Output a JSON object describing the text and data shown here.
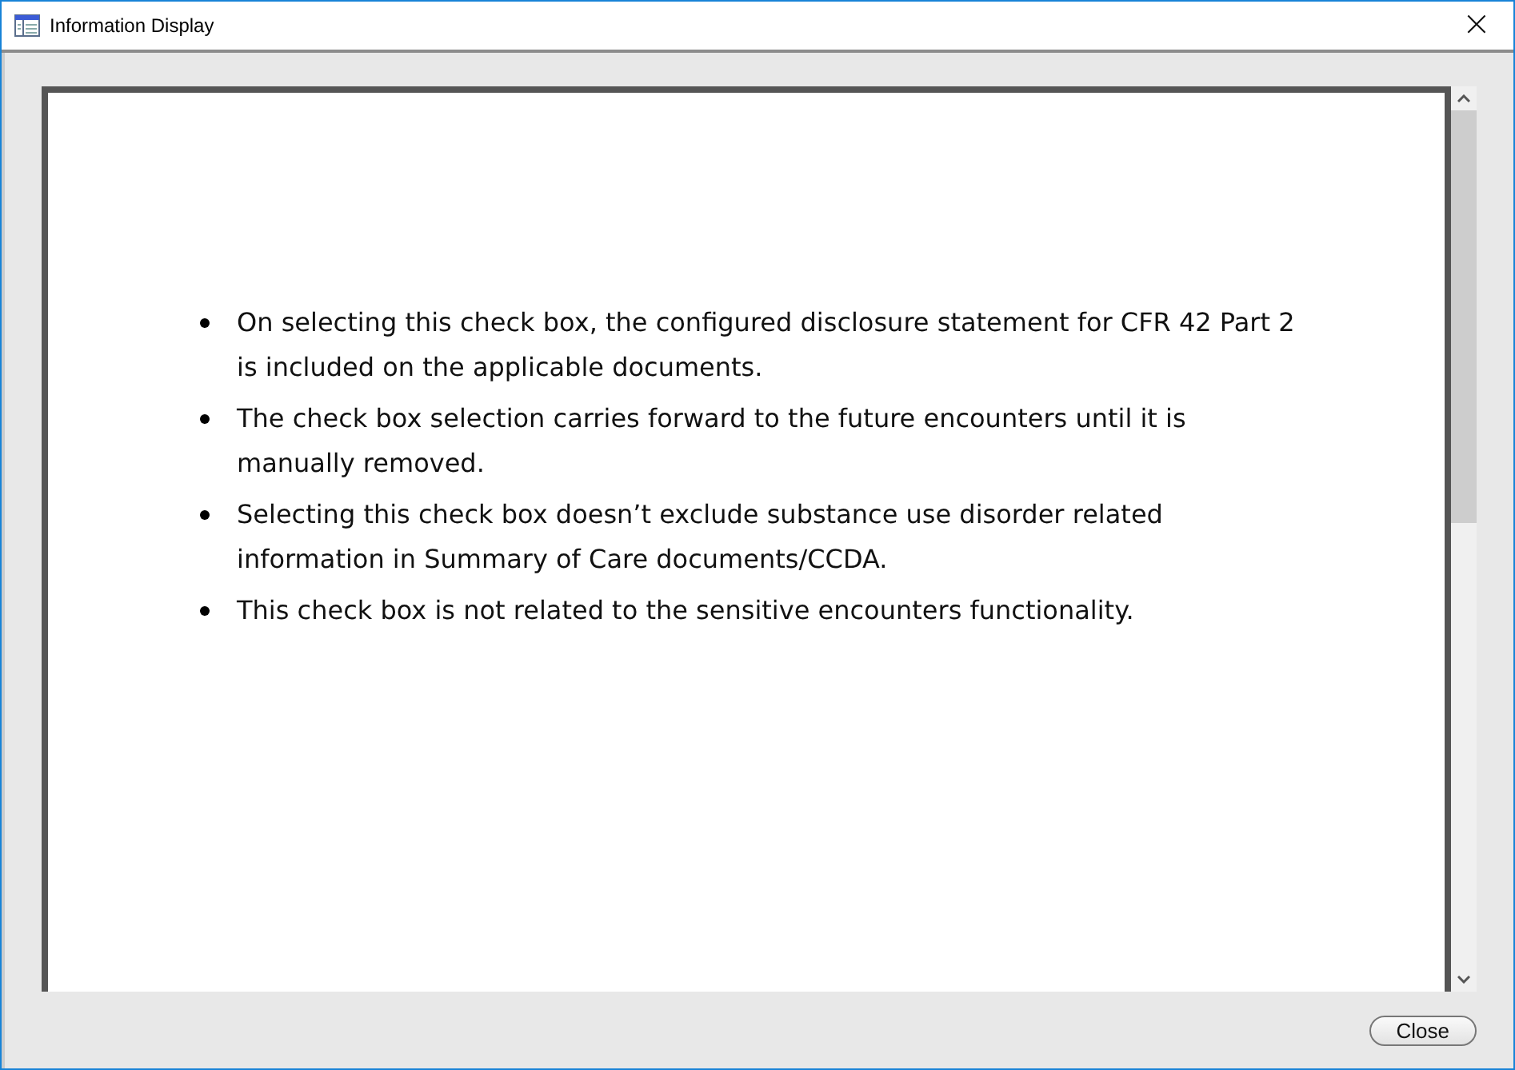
{
  "window": {
    "title": "Information Display",
    "close_glyph": "×"
  },
  "document": {
    "bullets": [
      "On selecting this check box, the configured disclosure statement for CFR 42 Part 2 is included on the applicable documents.",
      "The check box selection carries forward to the future encounters until it is manually removed.",
      "Selecting this check box doesn’t exclude substance use disorder related information in Summary of Care documents/CCDA.",
      "This check box is not related to the sensitive encounters functionality."
    ]
  },
  "buttons": [
    "Close"
  ]
}
